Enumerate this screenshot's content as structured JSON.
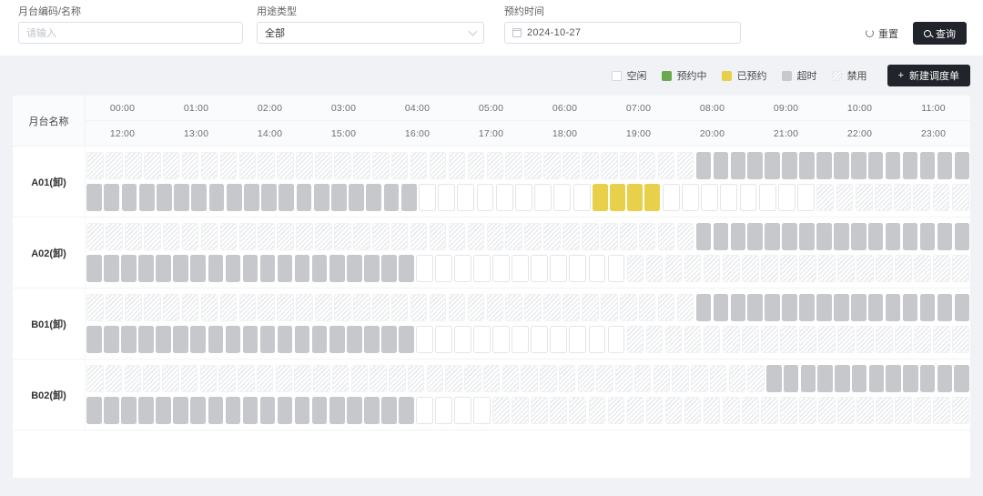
{
  "filters": {
    "dock_name": {
      "label": "月台编码/名称",
      "placeholder": "请输入",
      "value": ""
    },
    "usage_type": {
      "label": "用途类型",
      "value": "全部"
    },
    "booking_date": {
      "label": "预约时间",
      "value": "2024-10-27"
    },
    "reset_label": "重置",
    "search_label": "查询"
  },
  "legend": {
    "items": [
      {
        "label": "空闲",
        "color": "#ffffff",
        "key": "idle"
      },
      {
        "label": "预约中",
        "color": "#6aa84f",
        "key": "booking"
      },
      {
        "label": "已预约",
        "color": "#e8d04a",
        "key": "booked"
      },
      {
        "label": "超时",
        "color": "#c6c8cb",
        "key": "over"
      },
      {
        "label": "禁用",
        "color": "#f2f3f5",
        "key": "disabled"
      }
    ],
    "new_order_label": "新建调度单"
  },
  "schedule": {
    "label_column_header": "月台名称",
    "hours_upper": [
      "00:00",
      "01:00",
      "02:00",
      "03:00",
      "04:00",
      "05:00",
      "06:00",
      "07:00",
      "08:00",
      "09:00",
      "10:00",
      "11:00"
    ],
    "hours_lower": [
      "12:00",
      "13:00",
      "14:00",
      "15:00",
      "16:00",
      "17:00",
      "18:00",
      "19:00",
      "20:00",
      "21:00",
      "22:00",
      "23:00"
    ],
    "slots_per_hour": 4,
    "rows": [
      {
        "name": "A01(卸)",
        "tracks": [
          {
            "segments": [
              {
                "status": "disabled",
                "count": 32
              },
              {
                "status": "over",
                "count": 16
              }
            ]
          },
          {
            "segments": [
              {
                "status": "over",
                "count": 19
              },
              {
                "status": "idle",
                "count": 9
              },
              {
                "status": "booked",
                "count": 4
              },
              {
                "status": "idle",
                "count": 8
              },
              {
                "status": "disabled",
                "count": 8
              }
            ]
          }
        ]
      },
      {
        "name": "A02(卸)",
        "tracks": [
          {
            "segments": [
              {
                "status": "disabled",
                "count": 32
              },
              {
                "status": "over",
                "count": 16
              }
            ]
          },
          {
            "segments": [
              {
                "status": "over",
                "count": 19
              },
              {
                "status": "idle",
                "count": 11
              },
              {
                "status": "disabled",
                "count": 18
              }
            ]
          }
        ]
      },
      {
        "name": "B01(卸)",
        "tracks": [
          {
            "segments": [
              {
                "status": "disabled",
                "count": 32
              },
              {
                "status": "over",
                "count": 16
              }
            ]
          },
          {
            "segments": [
              {
                "status": "over",
                "count": 19
              },
              {
                "status": "idle",
                "count": 11
              },
              {
                "status": "disabled",
                "count": 18
              }
            ]
          }
        ]
      },
      {
        "name": "B02(卸)",
        "tracks": [
          {
            "segments": [
              {
                "status": "disabled",
                "count": 36
              },
              {
                "status": "over",
                "count": 12
              }
            ]
          },
          {
            "segments": [
              {
                "status": "over",
                "count": 19
              },
              {
                "status": "idle",
                "count": 4
              },
              {
                "status": "disabled",
                "count": 25
              }
            ]
          }
        ]
      }
    ]
  }
}
